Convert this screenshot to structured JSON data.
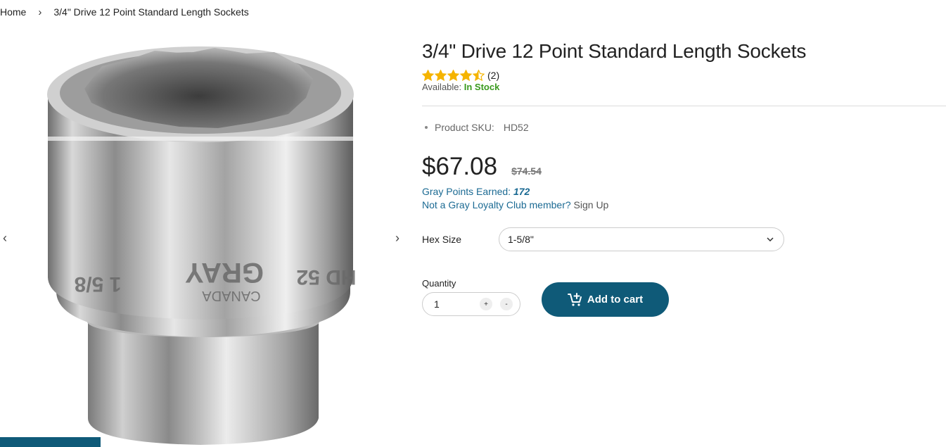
{
  "breadcrumb": {
    "home": "Home",
    "separator": "›",
    "current": "3/4\" Drive 12 Point Standard Length Sockets"
  },
  "gallery": {
    "prev_icon": "chevron-left-icon",
    "next_icon": "chevron-right-icon",
    "prev_glyph": "‹",
    "next_glyph": "›"
  },
  "product": {
    "title": "3/4\" Drive 12 Point Standard Length Sockets",
    "rating": 4.5,
    "review_count": "(2)",
    "availability_label": "Available:",
    "availability_value": "In Stock",
    "sku_label": "Product SKU:",
    "sku_value": "HD52",
    "price": "$67.08",
    "old_price": "$74.54",
    "points_label": "Gray Points Earned:",
    "points_value": "172",
    "loyalty_text": "Not a Gray Loyalty Club member?",
    "signup_text": "Sign Up"
  },
  "options": {
    "hex_label": "Hex Size",
    "hex_selected": "1-5/8\"",
    "chevron": "⌄"
  },
  "purchase": {
    "quantity_label": "Quantity",
    "quantity_value": "1",
    "plus": "+",
    "minus": "-",
    "add_to_cart": "Add to cart"
  },
  "colors": {
    "brand": "#0f5a78",
    "star": "#f5b400",
    "in_stock": "#3a9a1e",
    "link": "#1b6a93"
  }
}
